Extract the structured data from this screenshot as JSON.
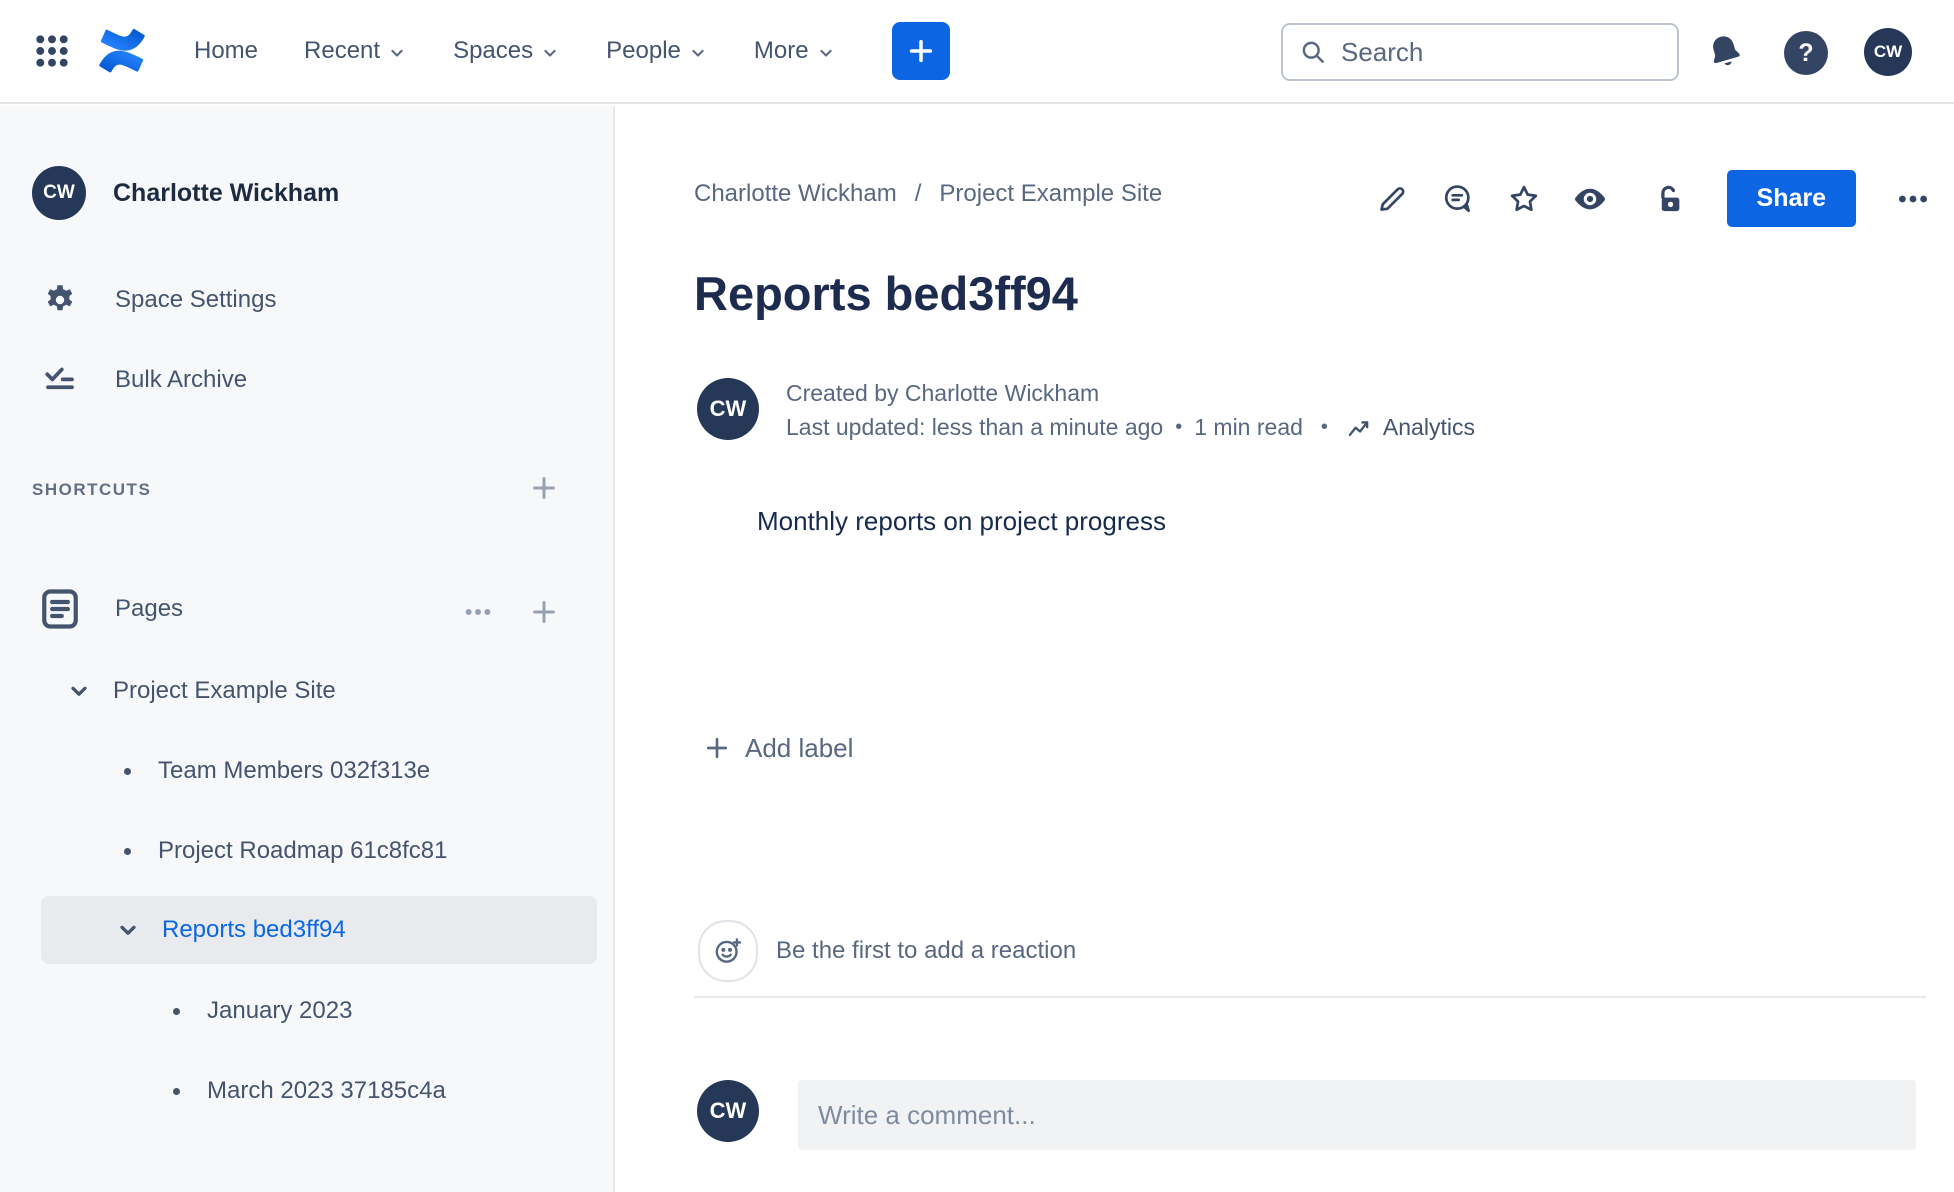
{
  "colors": {
    "brand_blue": "#0C66E4",
    "nav_text": "#44546F",
    "heading_text": "#1D2B4E",
    "muted_text": "#626F86",
    "avatar_navy": "#253858",
    "sidebar_bg": "#F7F8F9",
    "selected_item_bg": "#E9EAEE"
  },
  "top_nav": {
    "menu_items": [
      {
        "label": "Home",
        "has_dropdown": false
      },
      {
        "label": "Recent",
        "has_dropdown": true
      },
      {
        "label": "Spaces",
        "has_dropdown": true
      },
      {
        "label": "People",
        "has_dropdown": true
      },
      {
        "label": "More",
        "has_dropdown": true
      }
    ],
    "search_placeholder": "Search",
    "profile_initials": "CW"
  },
  "sidebar": {
    "space_avatar_initials": "CW",
    "space_name": "Charlotte Wickham",
    "nav_items": [
      {
        "label": "Space Settings"
      },
      {
        "label": "Bulk Archive"
      }
    ],
    "shortcuts_heading": "SHORTCUTS",
    "pages_heading": "Pages",
    "tree": {
      "root_label": "Project Example Site",
      "child_1": "Team Members 032f313e",
      "child_2": "Project Roadmap 61c8fc81",
      "selected_label": "Reports bed3ff94",
      "grandchild_1": "January 2023",
      "grandchild_2": "March 2023 37185c4a"
    }
  },
  "content": {
    "breadcrumb": {
      "crumb_1": "Charlotte Wickham",
      "separator": "/",
      "crumb_2": "Project Example Site"
    },
    "share_button_label": "Share",
    "page_title": "Reports bed3ff94",
    "byline": {
      "avatar_initials": "CW",
      "created_by": "Created by Charlotte Wickham",
      "last_updated": "Last updated: less than a minute ago",
      "separator": "•",
      "read_time": "1 min read",
      "analytics_label": "Analytics"
    },
    "body_text": "Monthly reports on project progress",
    "add_label_text": "Add label",
    "reaction_prompt": "Be the first to add a reaction",
    "comment_placeholder": "Write a comment...",
    "comment_avatar_initials": "CW"
  },
  "icons": {
    "app-grid-icon": "3x3 dot grid",
    "confluence-logo": "two blue interlocking swooshes",
    "chevron-down-icon": "downward chevron",
    "plus-icon": "plus sign",
    "search-icon": "magnifying glass",
    "bell-icon": "filled tilted bell",
    "help-icon": "question mark in circle",
    "gear-icon": "settings cog",
    "bulk-archive-icon": "checkmark with list lines",
    "pages-icon": "document with text lines",
    "ellipsis-icon": "three horizontal dots",
    "bullet-dot": "small round bullet",
    "edit-pencil-icon": "pencil outline",
    "comment-bubble-icon": "speech bubble with lines",
    "star-icon": "star outline",
    "watch-eye-icon": "filled eye",
    "unlock-icon": "open padlock",
    "analytics-icon": "trend line with arrow",
    "emoji-add-icon": "smiley face with plus"
  }
}
